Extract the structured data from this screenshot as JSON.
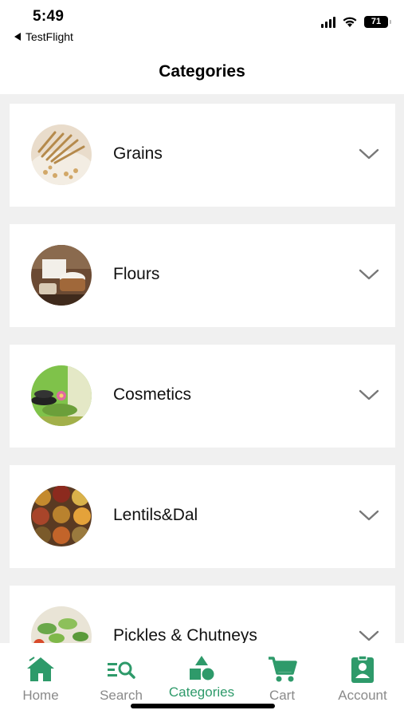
{
  "status_bar": {
    "time": "5:49",
    "back_app": "TestFlight",
    "battery": "71"
  },
  "header": {
    "title": "Categories"
  },
  "categories": [
    {
      "label": "Grains",
      "icon": "chevron-down-icon"
    },
    {
      "label": "Flours",
      "icon": "chevron-down-icon"
    },
    {
      "label": "Cosmetics",
      "icon": "chevron-down-icon"
    },
    {
      "label": "Lentils&Dal",
      "icon": "chevron-down-icon"
    },
    {
      "label": "Pickles & Chutneys",
      "icon": "chevron-down-icon"
    }
  ],
  "tabbar": {
    "tabs": [
      {
        "label": "Home",
        "icon": "home-icon"
      },
      {
        "label": "Search",
        "icon": "search-icon"
      },
      {
        "label": "Categories",
        "icon": "categories-icon",
        "active": true
      },
      {
        "label": "Cart",
        "icon": "cart-icon"
      },
      {
        "label": "Account",
        "icon": "account-icon"
      }
    ]
  },
  "colors": {
    "accent": "#2e9a6a",
    "inactive_tab": "#8a8a8a",
    "list_background": "#f0f0f0"
  }
}
